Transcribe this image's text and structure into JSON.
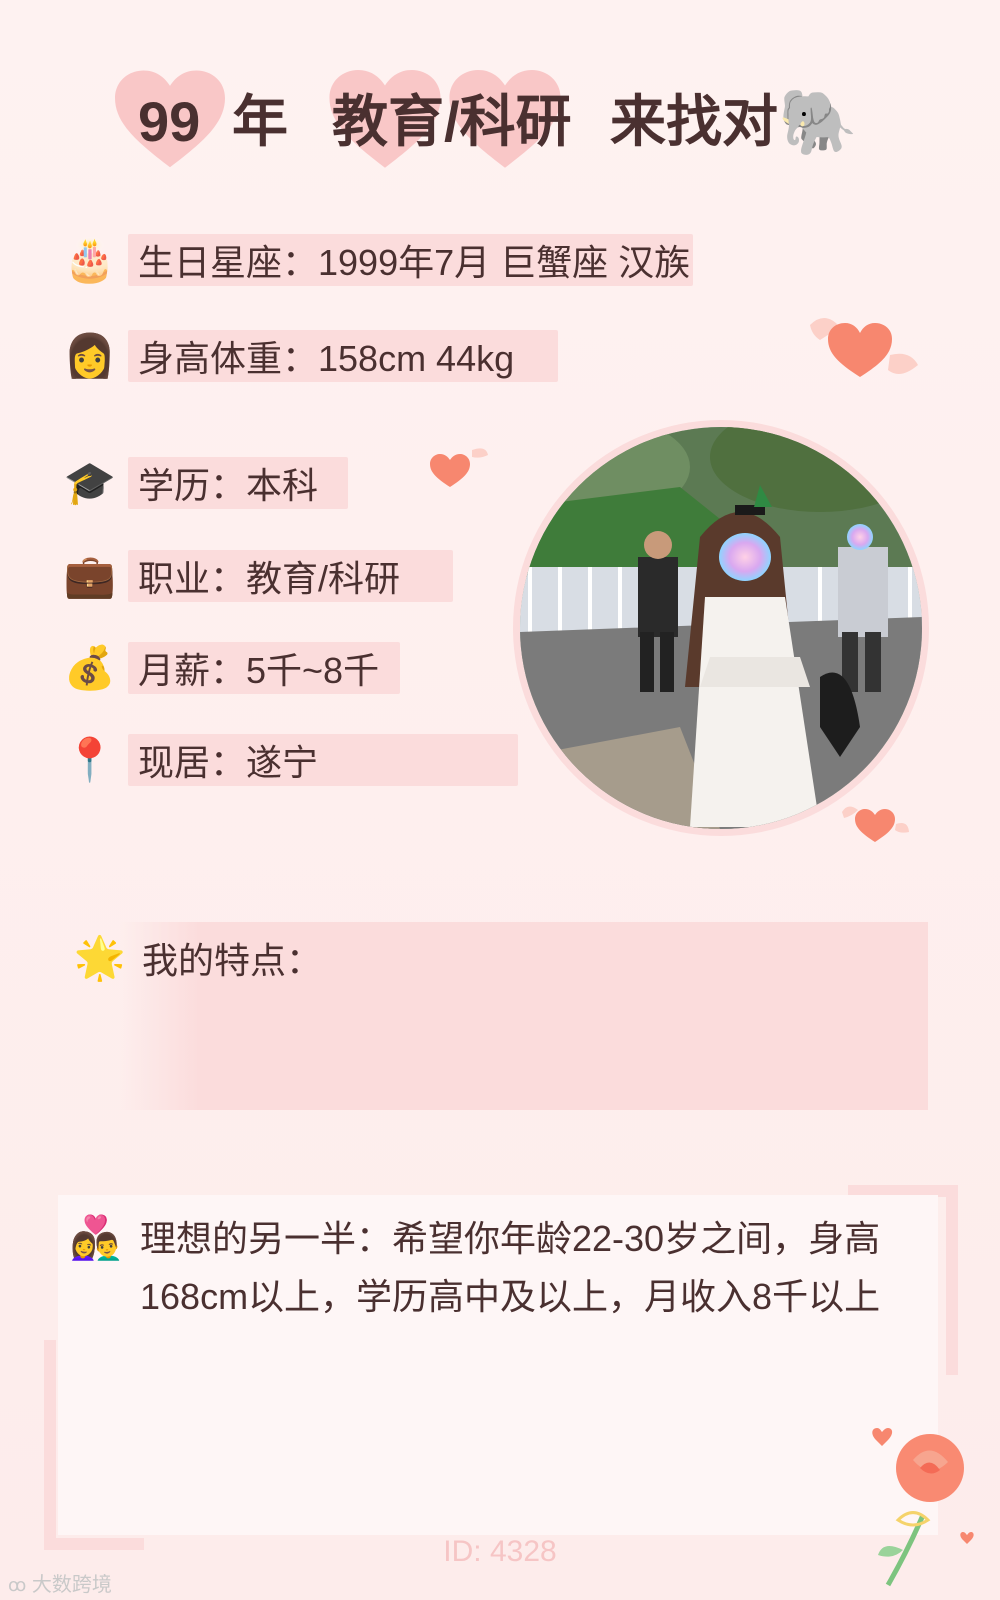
{
  "header": {
    "year": "99",
    "year_suffix": "年",
    "profession": "教育/科研",
    "looking": "来找对",
    "elephant_icon": "elephant-emoji"
  },
  "info": [
    {
      "icon": "birthday-cake-icon",
      "glyph": "🎂",
      "text": "生日星座：1999年7月 巨蟹座 汉族"
    },
    {
      "icon": "woman-icon",
      "glyph": "👩",
      "text": "身高体重：158cm 44kg"
    },
    {
      "icon": "graduation-cap-icon",
      "glyph": "🎓",
      "text": "学历：本科"
    },
    {
      "icon": "briefcase-icon",
      "glyph": "💼",
      "text": "职业：教育/科研"
    },
    {
      "icon": "money-bag-icon",
      "glyph": "💰",
      "text": "月薪：5千~8千"
    },
    {
      "icon": "location-pin-icon",
      "glyph": "📍",
      "text": "现居：遂宁"
    }
  ],
  "traits": {
    "icon": "star-icon",
    "glyph": "🌟",
    "label": "我的特点："
  },
  "ideal": {
    "icon": "couple-heart-icon",
    "glyph": "👩‍❤️‍👨",
    "text": "理想的另一半：希望你年龄22-30岁之间，身高168cm以上，学历高中及以上，月收入8千以上"
  },
  "footer": {
    "id": "ID: 4328",
    "watermark": "大数跨境"
  },
  "colors": {
    "band": "#fbdcdc",
    "heart": "#f9c3c3",
    "text": "#4a3030"
  }
}
